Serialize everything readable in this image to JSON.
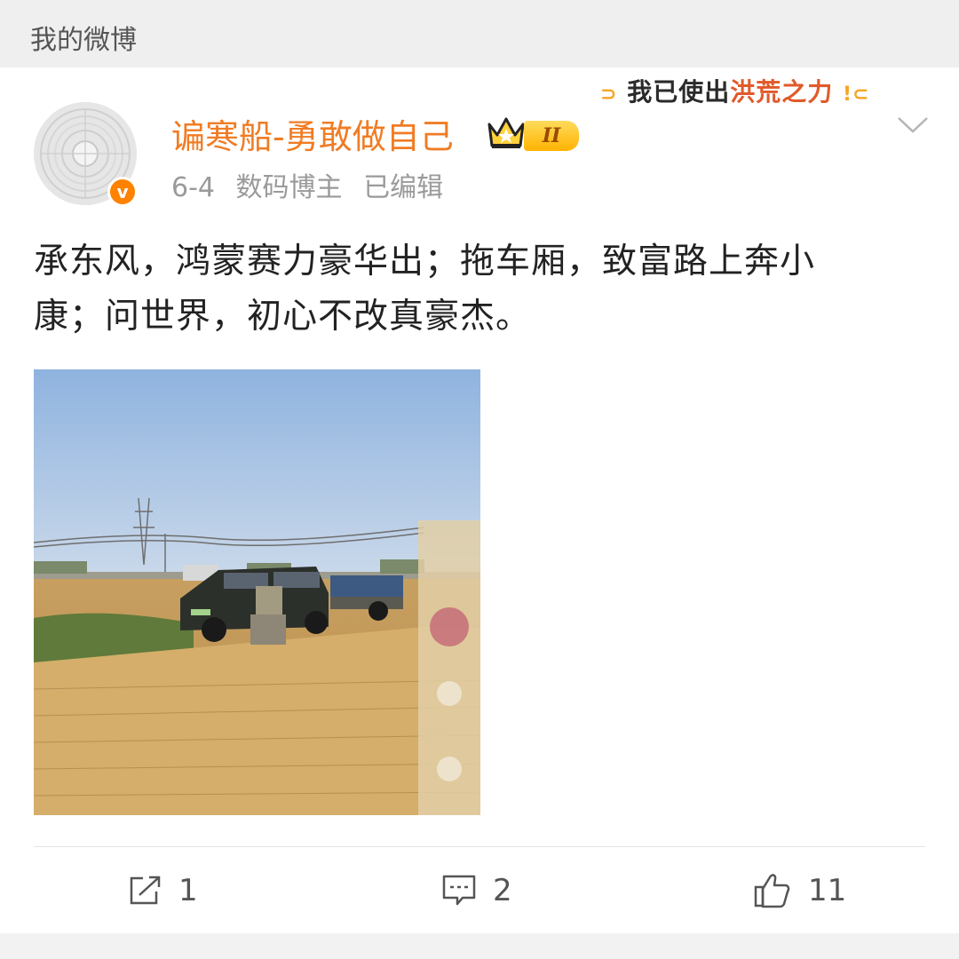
{
  "header": {
    "title": "我的微博"
  },
  "post": {
    "author": {
      "name": "谝寒船-勇敢做自己",
      "avatar_icon": "fan-avatar",
      "verified_icon": "verified-v-icon",
      "verified_mark": "v",
      "level_badge": "II"
    },
    "meta": {
      "date": "6-4",
      "role": "数码博主",
      "edited": "已编辑"
    },
    "decoration": {
      "prefix": "⊃",
      "text_main": "我已使出",
      "text_highlight": "洪荒之力",
      "suffix": "!⊂"
    },
    "text_line1": "承东风，鸿蒙赛力豪华出；拖车厢，致富路上奔小",
    "text_line2": "康；问世界，初心不改真豪杰。",
    "image_alt": "black SUV towing trailer in wheat field"
  },
  "actions": {
    "repost_count": "1",
    "comment_count": "2",
    "like_count": "11"
  },
  "colors": {
    "username": "#f07c24",
    "verified": "#ff8200",
    "badge": "#ffb300"
  }
}
